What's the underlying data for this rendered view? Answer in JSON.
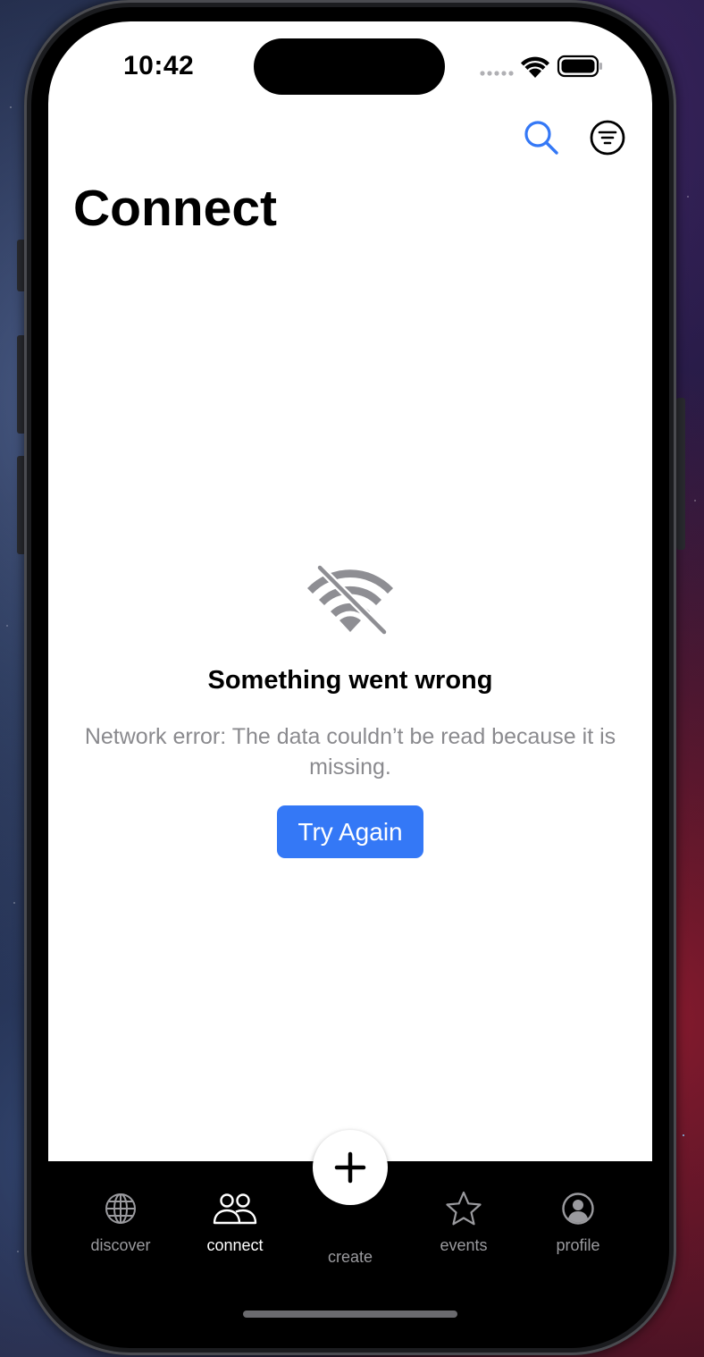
{
  "status_bar": {
    "time": "10:42"
  },
  "header": {
    "title": "Connect",
    "search_icon": "search-icon",
    "filter_icon": "filter-icon"
  },
  "error_state": {
    "icon": "wifi-off-icon",
    "title": "Something went wrong",
    "message": "Network error: The data couldn’t be read because it is missing.",
    "retry_label": "Try Again"
  },
  "tab_bar": {
    "active": "connect",
    "items": [
      {
        "id": "discover",
        "label": "discover",
        "icon": "globe-icon"
      },
      {
        "id": "connect",
        "label": "connect",
        "icon": "people-icon"
      },
      {
        "id": "create",
        "label": "create",
        "icon": "plus-icon"
      },
      {
        "id": "events",
        "label": "events",
        "icon": "star-icon"
      },
      {
        "id": "profile",
        "label": "profile",
        "icon": "person-circle-icon"
      }
    ]
  },
  "colors": {
    "accent": "#3478f6",
    "secondary_text": "#8a8a8e",
    "tab_inactive": "#9a9a9e",
    "error_icon": "#8e8e93"
  }
}
